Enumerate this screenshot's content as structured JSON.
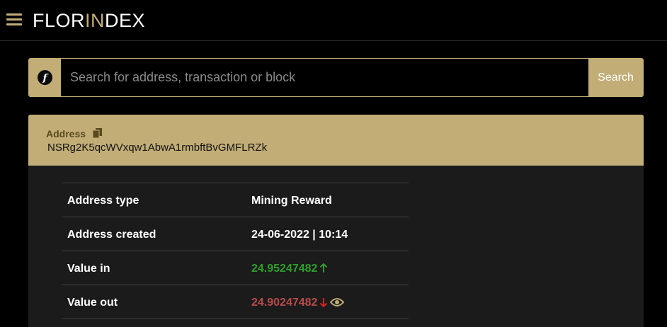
{
  "header": {
    "logo_part1": "FLOR",
    "logo_accent": "IN",
    "logo_part2": "DEX"
  },
  "search": {
    "placeholder": "Search for address, transaction or block",
    "button_label": "Search"
  },
  "address_card": {
    "label": "Address",
    "value": "NSRg2K5qcWVxqw1AbwA1rmbftBvGMFLRZk"
  },
  "details": [
    {
      "key": "Address type",
      "value": "Mining Reward"
    },
    {
      "key": "Address created",
      "value": "24-06-2022 | 10:14"
    },
    {
      "key": "Value in",
      "value": "24.95247482"
    },
    {
      "key": "Value out",
      "value": "24.90247482"
    }
  ],
  "colors": {
    "accent": "#c2ad76",
    "value_in": "#2f9e2a",
    "value_out": "#b84a4a",
    "arrow_down": "#e02020"
  },
  "icons": {
    "menu": "hamburger-icon",
    "search_logo": "flo-logo-icon",
    "copy": "copy-icon",
    "arrow_up": "arrow-up-icon",
    "arrow_down": "arrow-down-icon",
    "view": "eye-icon"
  }
}
